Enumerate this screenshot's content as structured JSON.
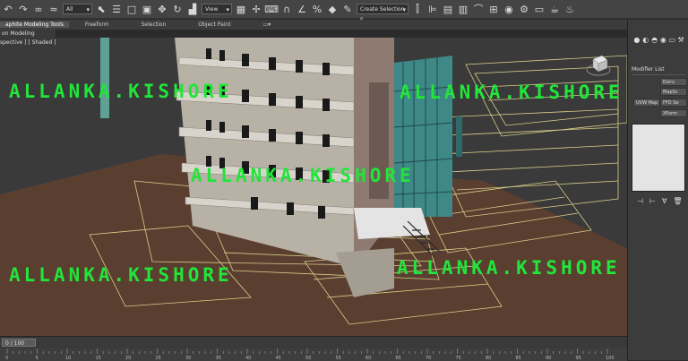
{
  "toolbar": {
    "filter_value": "All",
    "view_value": "View",
    "selection_set_placeholder": "Create Selection S",
    "icons": [
      "undo-icon",
      "redo-icon",
      "link-icon",
      "unlink-icon",
      "bind-space-warp-icon",
      "filter-dropdown",
      "select-object-icon",
      "select-by-name-icon",
      "rect-select-region-icon",
      "window-crossing-icon",
      "select-move-icon",
      "select-rotate-icon",
      "select-scale-icon",
      "view-dropdown",
      "pivot-icon",
      "select-manipulate-icon",
      "keyboard-shortcut-icon",
      "snap-3-icon",
      "angle-snap-icon",
      "percent-snap-icon",
      "spinner-snap-icon",
      "edit-named-sel-icon",
      "mirror-icon",
      "align-icon",
      "toggle-layer-icon",
      "graphite-toggle-icon",
      "curve-editor-icon",
      "schematic-view-icon",
      "material-editor-icon",
      "render-setup-icon",
      "rendered-frame-icon",
      "render-icon",
      "teapot-icon"
    ]
  },
  "ribbon": {
    "tabs": [
      "aphite Modeling Tools",
      "Freeform",
      "Selection",
      "Object Paint"
    ],
    "panel": "on Modeling"
  },
  "viewport": {
    "label": "spective ] [ Shaded ]"
  },
  "command_panel": {
    "modifier_list": "Modifier List",
    "buttons": [
      "Extru",
      "MapSc",
      "UVW Map",
      "FFD Se",
      "XForm"
    ]
  },
  "timeline": {
    "frame": "0 / 100",
    "ticks": [
      "0",
      "5",
      "10",
      "15",
      "20",
      "25",
      "30",
      "35",
      "40",
      "45",
      "50",
      "55",
      "60",
      "65",
      "70",
      "75",
      "80",
      "85",
      "90",
      "95",
      "100"
    ]
  },
  "watermark": {
    "texts": [
      "ALLANKA.KISHORE",
      "ALLANKA.KISHORE",
      "ALLANKA.KISHORE",
      "ALLANKA.KISHORE",
      "ALLANKA.KISHORE"
    ]
  }
}
